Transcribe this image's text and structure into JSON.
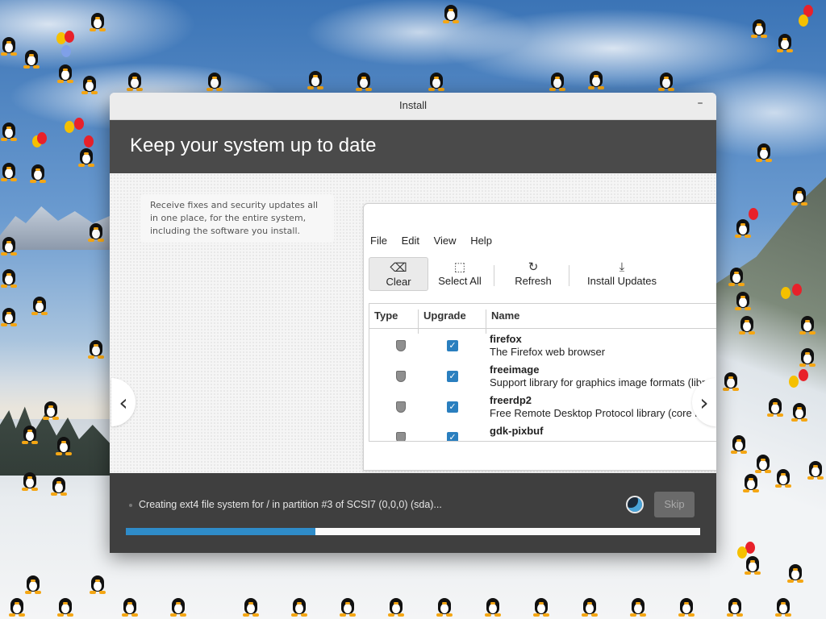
{
  "window": {
    "title": "Install",
    "minimize_glyph": "–"
  },
  "header": {
    "title": "Keep your system up to date"
  },
  "slide": {
    "description": "Receive fixes and security updates all in one place, for the entire system, including the software you install.",
    "prev_glyph": "‹",
    "next_glyph": "›"
  },
  "update_manager": {
    "menu": [
      "File",
      "Edit",
      "View",
      "Help"
    ],
    "toolbar": [
      {
        "label": "Clear",
        "icon": "backspace-icon",
        "glyph": "⌫",
        "active": true
      },
      {
        "label": "Select All",
        "icon": "select-all-icon",
        "glyph": "⬚",
        "active": false
      },
      {
        "label": "Refresh",
        "icon": "refresh-icon",
        "glyph": "↻",
        "active": false
      },
      {
        "label": "Install Updates",
        "icon": "download-icon",
        "glyph": "⤓",
        "active": false
      }
    ],
    "columns": [
      "Type",
      "Upgrade",
      "Name"
    ],
    "rows": [
      {
        "name": "firefox",
        "description": "The Firefox web browser",
        "checked": true
      },
      {
        "name": "freeimage",
        "description": "Support library for graphics image formats (libr",
        "checked": true
      },
      {
        "name": "freerdp2",
        "description": "Free Remote Desktop Protocol library (core libr",
        "checked": true
      },
      {
        "name": "gdk-pixbuf",
        "description": "",
        "checked": true
      }
    ]
  },
  "footer": {
    "status": "Creating ext4 file system for / in partition #3 of SCSI7 (0,0,0) (sda)...",
    "skip_label": "Skip",
    "progress_fraction": 0.33
  },
  "colors": {
    "header_bg": "#4a4a4a",
    "footer_bg": "#3f3f3f",
    "accent": "#2f8cc9",
    "checkbox": "#2a7fbf"
  }
}
